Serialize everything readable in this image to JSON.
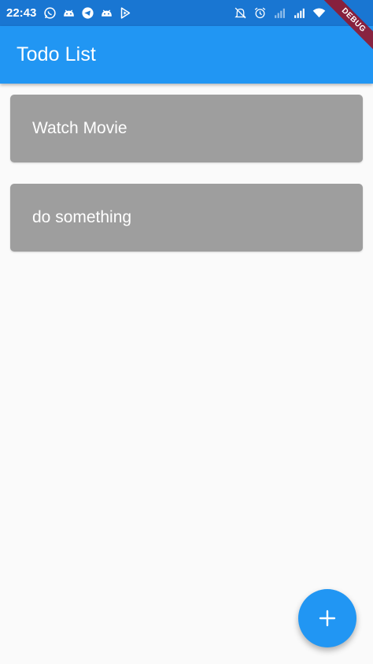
{
  "status_bar": {
    "time": "22:43",
    "left_icons": [
      "whatsapp-icon",
      "android-icon",
      "telegram-icon",
      "android-icon",
      "play-store-icon"
    ],
    "right_icons": [
      "notifications-off-icon",
      "alarm-icon",
      "signal-icon",
      "signal-icon",
      "wifi-icon",
      "battery-charging-icon"
    ]
  },
  "debug_banner": {
    "label": "DEBUG"
  },
  "app_bar": {
    "title": "Todo List"
  },
  "todos": [
    {
      "label": "Watch Movie"
    },
    {
      "label": "do something"
    }
  ],
  "fab": {
    "icon": "add-icon"
  },
  "colors": {
    "status_bar": "#1976d2",
    "app_bar": "#2196f3",
    "todo_card": "#9e9e9e",
    "background": "#fafafa",
    "fab": "#2196f3"
  }
}
